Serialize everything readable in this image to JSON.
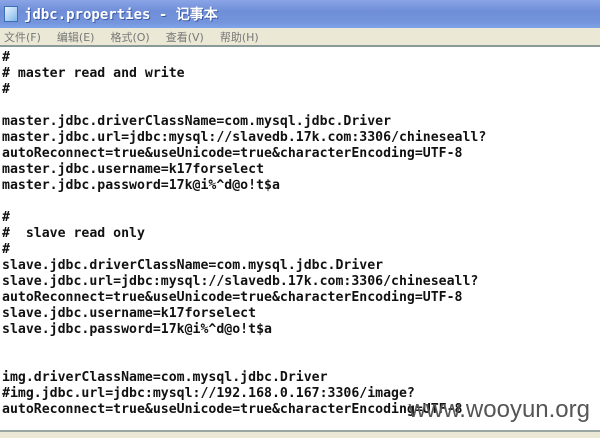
{
  "window": {
    "title": "jdbc.properties - 记事本"
  },
  "menu": [
    "文件(F)",
    "编辑(E)",
    "格式(O)",
    "查看(V)",
    "帮助(H)"
  ],
  "lines": [
    "#",
    "# master read and write",
    "#",
    "",
    "master.jdbc.driverClassName=com.mysql.jdbc.Driver",
    "master.jdbc.url=jdbc:mysql://slavedb.17k.com:3306/chineseall?",
    "autoReconnect=true&useUnicode=true&characterEncoding=UTF-8",
    "master.jdbc.username=k17forselect",
    "master.jdbc.password=17k@i%^d@o!t$a",
    "",
    "#",
    "#  slave read only",
    "#",
    "slave.jdbc.driverClassName=com.mysql.jdbc.Driver",
    "slave.jdbc.url=jdbc:mysql://slavedb.17k.com:3306/chineseall?",
    "autoReconnect=true&useUnicode=true&characterEncoding=UTF-8",
    "slave.jdbc.username=k17forselect",
    "slave.jdbc.password=17k@i%^d@o!t$a",
    "",
    "",
    "img.driverClassName=com.mysql.jdbc.Driver",
    "#img.jdbc.url=jdbc:mysql://192.168.0.167:3306/image?",
    "autoReconnect=true&useUnicode=true&characterEncoding=UTF-8"
  ],
  "watermark": "www.wooyun.org"
}
